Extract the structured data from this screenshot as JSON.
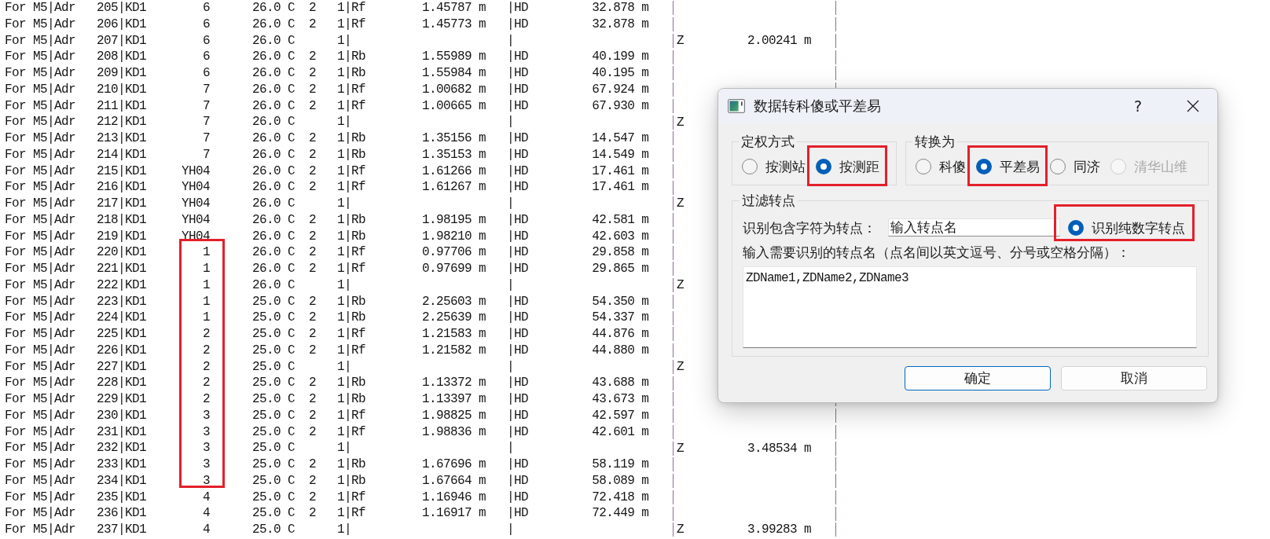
{
  "listing": {
    "blocks": [
      {
        "boxed": false,
        "rows": [
          {
            "line": "For M5|Adr   205|KD1        6      26.0 C  2   1|Rf        1.45787 m   |HD         32.878 m"
          },
          {
            "line": "For M5|Adr   206|KD1        6      26.0 C  2   1|Rf        1.45773 m   |HD         32.878 m"
          },
          {
            "line": "For M5|Adr   207|KD1        6      26.0 C      1|                      |",
            "z": "Z         2.00241 m"
          },
          {
            "line": "For M5|Adr   208|KD1        6      26.0 C  2   1|Rb        1.55989 m   |HD         40.199 m"
          },
          {
            "line": "For M5|Adr   209|KD1        6      26.0 C  2   1|Rb        1.55984 m   |HD         40.195 m"
          },
          {
            "line": "For M5|Adr   210|KD1        7      26.0 C  2   1|Rf        1.00682 m   |HD         67.924 m"
          },
          {
            "line": "For M5|Adr   211|KD1        7      26.0 C  2   1|Rf        1.00665 m   |HD         67.930 m"
          },
          {
            "line": "For M5|Adr   212|KD1        7      26.0 C      1|                      |",
            "z": "Z"
          },
          {
            "line": "For M5|Adr   213|KD1        7      26.0 C  2   1|Rb        1.35156 m   |HD         14.547 m"
          },
          {
            "line": "For M5|Adr   214|KD1        7      26.0 C  2   1|Rb        1.35153 m   |HD         14.549 m"
          },
          {
            "line": "For M5|Adr   215|KD1     YH04      26.0 C  2   1|Rf        1.61266 m   |HD         17.461 m"
          },
          {
            "line": "For M5|Adr   216|KD1     YH04      26.0 C  2   1|Rf        1.61267 m   |HD         17.461 m"
          },
          {
            "line": "For M5|Adr   217|KD1     YH04      26.0 C      1|                      |",
            "z": "Z"
          },
          {
            "line": "For M5|Adr   218|KD1     YH04      26.0 C  2   1|Rb        1.98195 m   |HD         42.581 m"
          },
          {
            "line": "For M5|Adr   219|KD1     YH04      26.0 C  2   1|Rb        1.98210 m   |HD         42.603 m"
          }
        ]
      },
      {
        "boxed": true,
        "rows": [
          {
            "line": "For M5|Adr   220|KD1        1      26.0 C  2   1|Rf        0.97706 m   |HD         29.858 m"
          },
          {
            "line": "For M5|Adr   221|KD1        1      26.0 C  2   1|Rf        0.97699 m   |HD         29.865 m"
          },
          {
            "line": "For M5|Adr   222|KD1        1      26.0 C      1|                      |",
            "z": "Z"
          },
          {
            "line": "For M5|Adr   223|KD1        1      25.0 C  2   1|Rb        2.25603 m   |HD         54.350 m"
          },
          {
            "line": "For M5|Adr   224|KD1        1      25.0 C  2   1|Rb        2.25639 m   |HD         54.337 m"
          },
          {
            "line": "For M5|Adr   225|KD1        2      25.0 C  2   1|Rf        1.21583 m   |HD         44.876 m"
          },
          {
            "line": "For M5|Adr   226|KD1        2      25.0 C  2   1|Rf        1.21582 m   |HD         44.880 m"
          },
          {
            "line": "For M5|Adr   227|KD1        2      25.0 C      1|                      |",
            "z": "Z"
          },
          {
            "line": "For M5|Adr   228|KD1        2      25.0 C  2   1|Rb        1.13372 m   |HD         43.688 m"
          },
          {
            "line": "For M5|Adr   229|KD1        2      25.0 C  2   1|Rb        1.13397 m   |HD         43.673 m"
          },
          {
            "line": "For M5|Adr   230|KD1        3      25.0 C  2   1|Rf        1.98825 m   |HD         42.597 m"
          },
          {
            "line": "For M5|Adr   231|KD1        3      25.0 C  2   1|Rf        1.98836 m   |HD         42.601 m"
          },
          {
            "line": "For M5|Adr   232|KD1        3      25.0 C      1|                      |",
            "z": "Z         3.48534 m"
          },
          {
            "line": "For M5|Adr   233|KD1        3      25.0 C  2   1|Rb        1.67696 m   |HD         58.119 m"
          },
          {
            "line": "For M5|Adr   234|KD1        3      25.0 C  2   1|Rb        1.67664 m   |HD         58.089 m"
          }
        ]
      },
      {
        "boxed": false,
        "rows": [
          {
            "line": "For M5|Adr   235|KD1        4      25.0 C  2   1|Rf        1.16946 m   |HD         72.418 m"
          },
          {
            "line": "For M5|Adr   236|KD1        4      25.0 C  2   1|Rf        1.16917 m   |HD         72.449 m"
          },
          {
            "line": "For M5|Adr   237|KD1        4      25.0 C      1|                      |",
            "z": "Z         3.99283 m"
          }
        ]
      }
    ]
  },
  "dialog": {
    "title": "数据转科傻或平差易",
    "help_button": "?",
    "weighting": {
      "legend": "定权方式",
      "options": [
        {
          "label": "按测站",
          "selected": false,
          "boxed": false
        },
        {
          "label": "按测距",
          "selected": true,
          "boxed": true
        }
      ]
    },
    "convert_to": {
      "legend": "转换为",
      "options": [
        {
          "label": "科傻",
          "selected": false,
          "disabled": false,
          "boxed": false
        },
        {
          "label": "平差易",
          "selected": true,
          "disabled": false,
          "boxed": true
        },
        {
          "label": "同济",
          "selected": false,
          "disabled": false,
          "boxed": false
        },
        {
          "label": "清华山维",
          "selected": false,
          "disabled": true,
          "boxed": false
        }
      ]
    },
    "filter": {
      "legend": "过滤转点",
      "contains_label": "识别包含字符为转点：",
      "contains_field": {
        "value": "输入转点名"
      },
      "numeric_option": {
        "label": "识别纯数字转点",
        "checked": true,
        "boxed": true
      },
      "names_label": "输入需要识别的转点名（点名间以英文逗号、分号或空格分隔）：",
      "names_field": {
        "value": "ZDName1,ZDName2,ZDName3"
      }
    },
    "buttons": [
      {
        "label": "确定",
        "kind": "primary"
      },
      {
        "label": "取消",
        "kind": "secondary"
      }
    ]
  }
}
